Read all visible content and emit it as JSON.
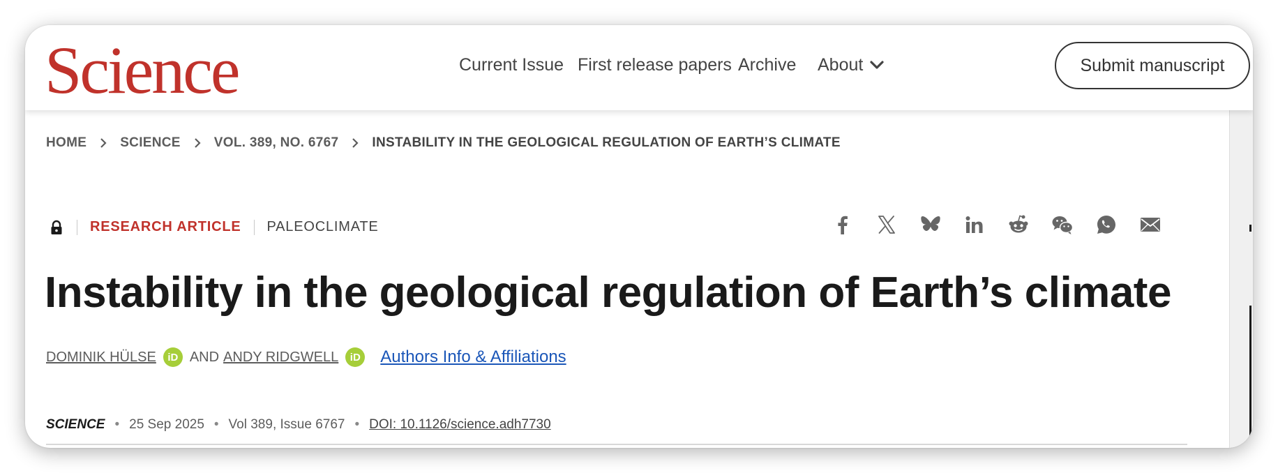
{
  "header": {
    "logo": "Science",
    "nav": [
      {
        "label": "Current Issue"
      },
      {
        "label": "First release papers"
      },
      {
        "label": "Archive"
      },
      {
        "label": "About"
      }
    ],
    "submit_label": "Submit manuscript"
  },
  "breadcrumb": [
    "HOME",
    "SCIENCE",
    "VOL. 389, NO. 6767",
    "INSTABILITY IN THE GEOLOGICAL REGULATION OF EARTH’S CLIMATE"
  ],
  "article": {
    "type": "RESEARCH ARTICLE",
    "subject": "PALEOCLIMATE",
    "title": "Instability in the geological regulation of Earth’s climate",
    "authors": [
      "DOMINIK HÜLSE",
      "ANDY RIDGWELL"
    ],
    "and_text": "AND",
    "orcid_badge": "iD",
    "affiliations_link": "Authors Info & Affiliations",
    "journal": "SCIENCE",
    "date": "25 Sep 2025",
    "volume": "Vol 389, Issue 6767",
    "doi": "DOI: 10.1126/science.adh7730",
    "separator": "•"
  },
  "share_icons": [
    "facebook-icon",
    "x-icon",
    "bluesky-icon",
    "linkedin-icon",
    "reddit-icon",
    "wechat-icon",
    "whatsapp-icon",
    "email-icon"
  ],
  "colors": {
    "brand_red": "#c0322b",
    "link_blue": "#1a56b8",
    "orcid_green": "#a6ce39"
  }
}
